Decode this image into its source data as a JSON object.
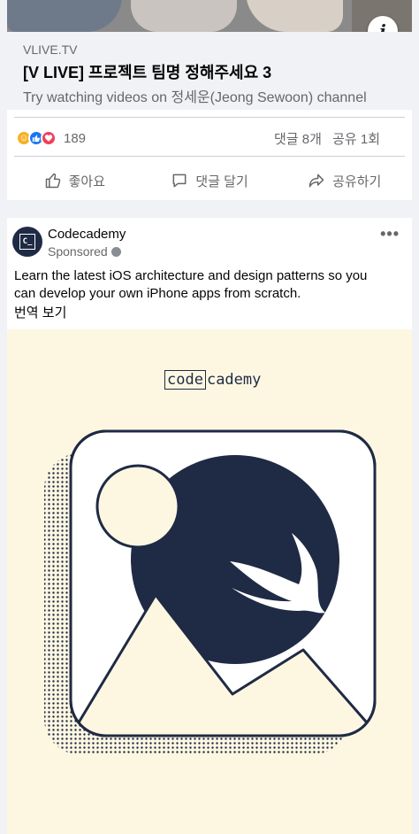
{
  "post1": {
    "domain": "VLIVE.TV",
    "title": "[V LIVE] 프로젝트 팀명 정해주세요 3",
    "description": "Try watching videos on 정세운(Jeong Sewoon) channel",
    "reaction_count": "189",
    "comments": "댓글 8개",
    "shares": "공유 1회",
    "actions": {
      "like": "좋아요",
      "comment": "댓글 달기",
      "share": "공유하기"
    }
  },
  "post2": {
    "page_name": "Codecademy",
    "sponsored": "Sponsored",
    "text": "Learn the latest iOS architecture and design patterns so you can develop your own iPhone apps from scratch.",
    "translate": "번역 보기",
    "creative": {
      "logo_boxed": "code",
      "logo_rest": "cademy"
    }
  },
  "colors": {
    "facebook_blue": "#1877f2",
    "navy": "#1f2a44",
    "cream": "#fdf7e2"
  }
}
